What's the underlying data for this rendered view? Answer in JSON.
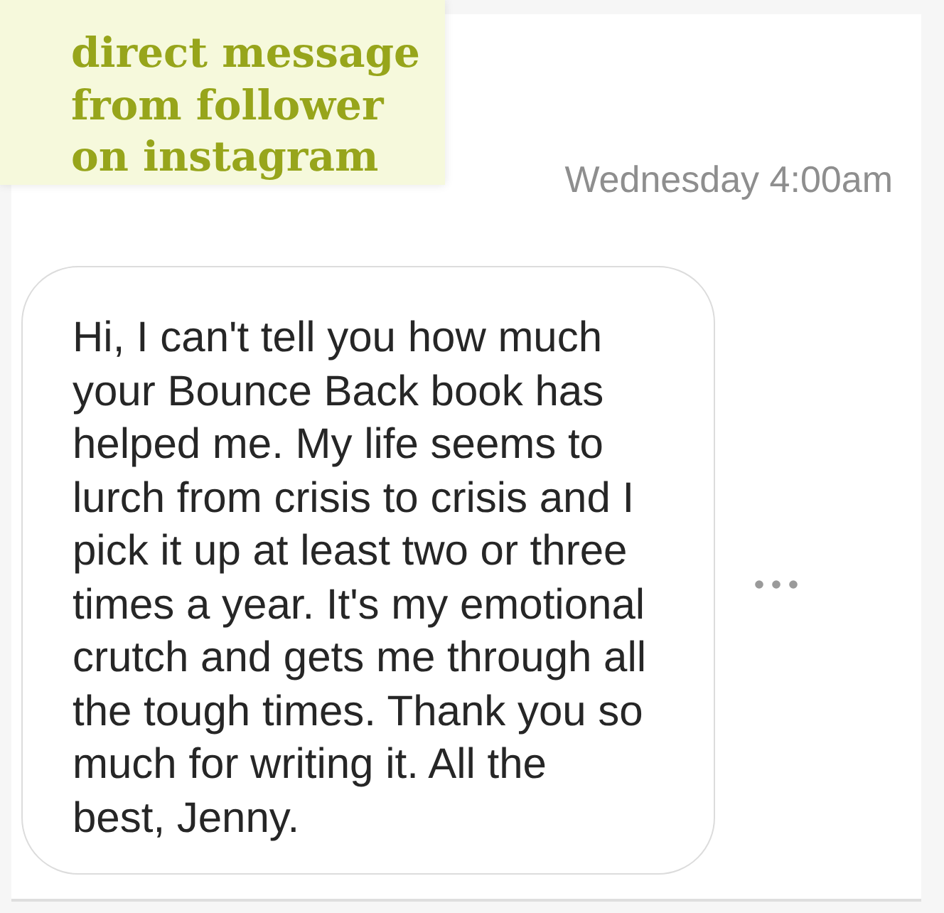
{
  "annotation": {
    "lines": [
      "direct message",
      "from follower",
      "on instagram"
    ]
  },
  "conversation": {
    "timestamp": "Wednesday 4:00am",
    "messages": [
      {
        "lines": [
          "Hi, I can't tell you how much",
          "your Bounce Back book has",
          "helped me. My life seems to",
          "lurch from crisis to crisis and I",
          "pick it up at least two or three",
          "times a year. It's my emotional",
          "crutch and gets me through all",
          "the tough times. Thank you so",
          "much for writing it. All the",
          "best, Jenny."
        ]
      }
    ]
  }
}
